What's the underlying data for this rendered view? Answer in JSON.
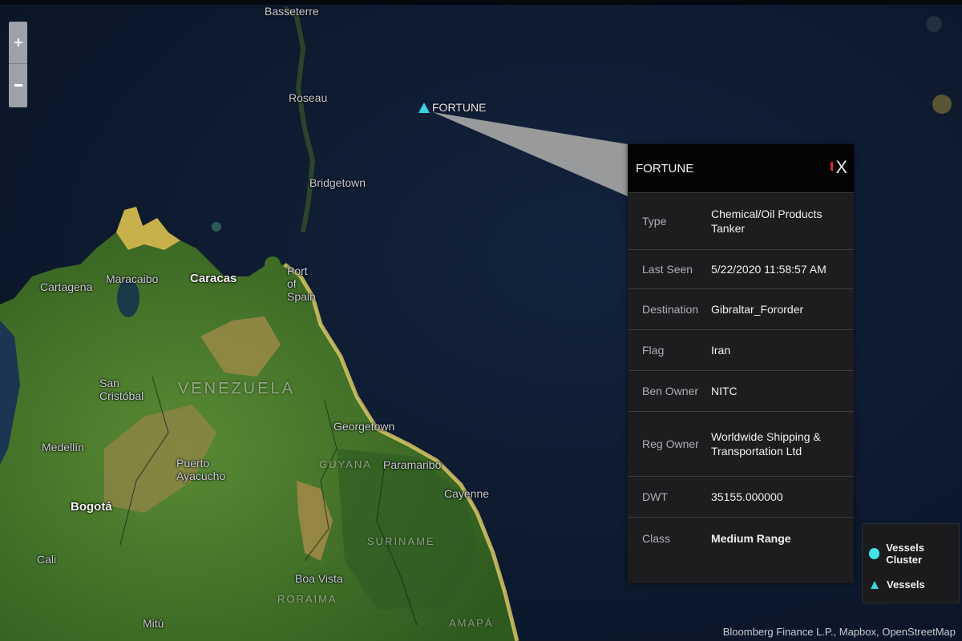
{
  "map": {
    "places": [
      {
        "key": "basseterre",
        "name": "Basseterre"
      },
      {
        "key": "roseau",
        "name": "Roseau"
      },
      {
        "key": "bridgetown",
        "name": "Bridgetown"
      },
      {
        "key": "cartagena",
        "name": "Cartagena"
      },
      {
        "key": "maracaibo",
        "name": "Maracaibo"
      },
      {
        "key": "caracas",
        "name": "Caracas"
      },
      {
        "key": "port_of_spain",
        "name": "Port of Spain"
      },
      {
        "key": "san_cristobal",
        "name": "San Cristóbal"
      },
      {
        "key": "medellin",
        "name": "Medellín"
      },
      {
        "key": "bogota",
        "name": "Bogotá"
      },
      {
        "key": "puerto_ayacucho",
        "name": "Puerto Ayacucho"
      },
      {
        "key": "georgetown",
        "name": "Georgetown"
      },
      {
        "key": "paramaribo",
        "name": "Paramaribo"
      },
      {
        "key": "cayenne",
        "name": "Cayenne"
      },
      {
        "key": "boa_vista",
        "name": "Boa Vista"
      },
      {
        "key": "cali",
        "name": "Cali"
      },
      {
        "key": "mitu",
        "name": "Mitú"
      }
    ],
    "regions": [
      {
        "key": "venezuela",
        "name": "VENEZUELA"
      },
      {
        "key": "guyana",
        "name": "GUYANA"
      },
      {
        "key": "suriname",
        "name": "SURINAME"
      },
      {
        "key": "roraima",
        "name": "RORAIMA"
      },
      {
        "key": "amapa",
        "name": "AMAPÁ"
      }
    ],
    "colors": {
      "ocean": "#0d1a2e",
      "land": "#4f7d2e",
      "land_dry": "#9a8a45",
      "coast": "#e3cf6a"
    }
  },
  "zoom": {
    "in_icon": "plus-icon",
    "out_icon": "minus-icon"
  },
  "vessel": {
    "label": "FORTUNE",
    "icon": "triangle-icon",
    "color": "#39d2de"
  },
  "popup": {
    "title": "FORTUNE",
    "flag_color": "#e0272b",
    "close": "X",
    "rows": [
      {
        "label": "Type",
        "value": "Chemical/Oil Products Tanker"
      },
      {
        "label": "Last Seen",
        "value": "5/22/2020 11:58:57 AM"
      },
      {
        "label": "Destination",
        "value": "Gibraltar_Fororder"
      },
      {
        "label": "Flag",
        "value": "Iran"
      },
      {
        "label": "Ben Owner",
        "value": "NITC"
      },
      {
        "label": "Reg Owner",
        "value": "Worldwide Shipping & Transportation Ltd"
      },
      {
        "label": "DWT",
        "value": "35155.000000"
      },
      {
        "label": "Class",
        "value": "Medium Range"
      }
    ]
  },
  "legend": {
    "cluster_label": "Vessels Cluster",
    "vessel_label": "Vessels",
    "cluster_color": "#3fe3ea"
  },
  "attribution": "Bloomberg Finance L.P., Mapbox, OpenStreetMap"
}
